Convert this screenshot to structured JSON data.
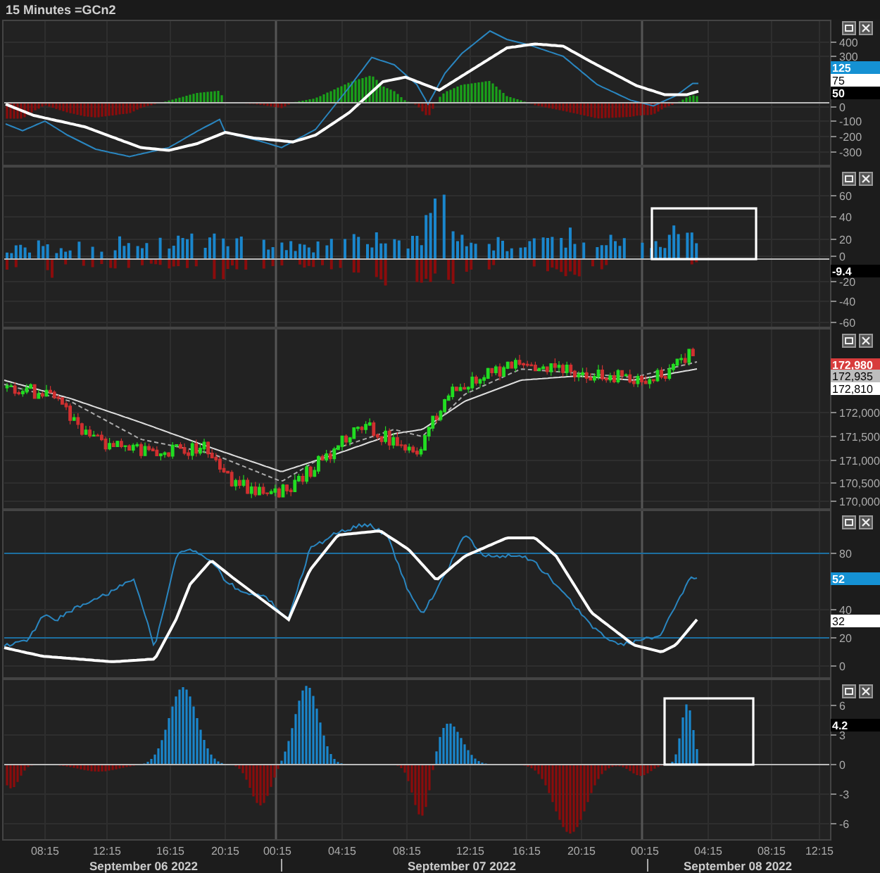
{
  "title": "15 Minutes =GCn2",
  "panels": [
    {
      "kind": "macd",
      "highlighted": false,
      "yticks": [
        "400",
        "300",
        "0",
        "-100",
        "-200",
        "-300"
      ],
      "tags": [
        {
          "text": "125",
          "color": "#1591d3"
        },
        {
          "text": "75",
          "color": "#ffffff"
        },
        {
          "text": "50",
          "color": "#000000"
        }
      ]
    },
    {
      "kind": "volume",
      "highlighted": true,
      "yticks": [
        "60",
        "40",
        "20",
        "0",
        "-20",
        "-40",
        "-60"
      ],
      "tags": [
        {
          "text": "-9.4",
          "color": "#000000"
        }
      ]
    },
    {
      "kind": "price",
      "highlighted": false,
      "yticks": [
        "172,000",
        "171,500",
        "171,000",
        "170,500",
        "170,000"
      ],
      "tags": [
        {
          "text": "172,980",
          "color": "#d83c3c"
        },
        {
          "text": "172,935",
          "color": "#bdbdbd"
        },
        {
          "text": "172,810",
          "color": "#ffffff"
        }
      ]
    },
    {
      "kind": "stochastic",
      "highlighted": false,
      "yticks": [
        "80",
        "40",
        "20",
        "0"
      ],
      "tags": [
        {
          "text": "52",
          "color": "#1591d3"
        },
        {
          "text": "32",
          "color": "#ffffff"
        }
      ]
    },
    {
      "kind": "oscillator",
      "highlighted": true,
      "yticks": [
        "6",
        "3",
        "0",
        "-3",
        "-6"
      ],
      "tags": [
        {
          "text": "4.2",
          "color": "#000000"
        }
      ]
    }
  ],
  "time_axis": {
    "times": [
      "08:15",
      "12:15",
      "16:15",
      "20:15",
      "00:15",
      "04:15",
      "08:15",
      "12:15",
      "16:15",
      "20:15",
      "00:15",
      "04:15",
      "08:15",
      "12:15"
    ],
    "dates": [
      "September 06 2022",
      "September 07 2022",
      "September 08 2022"
    ]
  }
}
